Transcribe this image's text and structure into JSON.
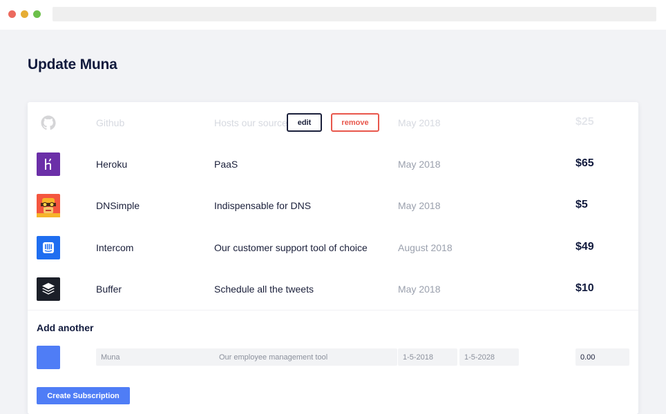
{
  "page": {
    "title": "Update Muna"
  },
  "subscriptions": [
    {
      "name": "Github",
      "description": "Hosts our source",
      "date": "May 2018",
      "price": "$25",
      "logo_icon": "github-icon",
      "logo_color": "#ffffff"
    },
    {
      "name": "Heroku",
      "description": "PaaS",
      "date": "May 2018",
      "price": "$65",
      "logo_icon": "heroku-icon",
      "logo_color": "#6b2fa8"
    },
    {
      "name": "DNSimple",
      "description": "Indispensable for DNS",
      "date": "May 2018",
      "price": "$5",
      "logo_icon": "dnsimple-icon",
      "logo_color": "#f4563f"
    },
    {
      "name": "Intercom",
      "description": "Our customer support tool of choice",
      "date": "August 2018",
      "price": "$49",
      "logo_icon": "intercom-icon",
      "logo_color": "#1f6ef0"
    },
    {
      "name": "Buffer",
      "description": "Schedule all the tweets",
      "date": "May 2018",
      "price": "$10",
      "logo_icon": "buffer-icon",
      "logo_color": "#1b1f28"
    }
  ],
  "row_actions": {
    "edit_label": "edit",
    "remove_label": "remove"
  },
  "add_form": {
    "title": "Add another",
    "swatch_color": "#4f7df6",
    "name_placeholder": "Muna",
    "description_placeholder": "Our employee management tool",
    "start_placeholder": "1-5-2018",
    "end_placeholder": "1-5-2028",
    "price_value": "0.00",
    "submit_label": "Create Subscription"
  }
}
